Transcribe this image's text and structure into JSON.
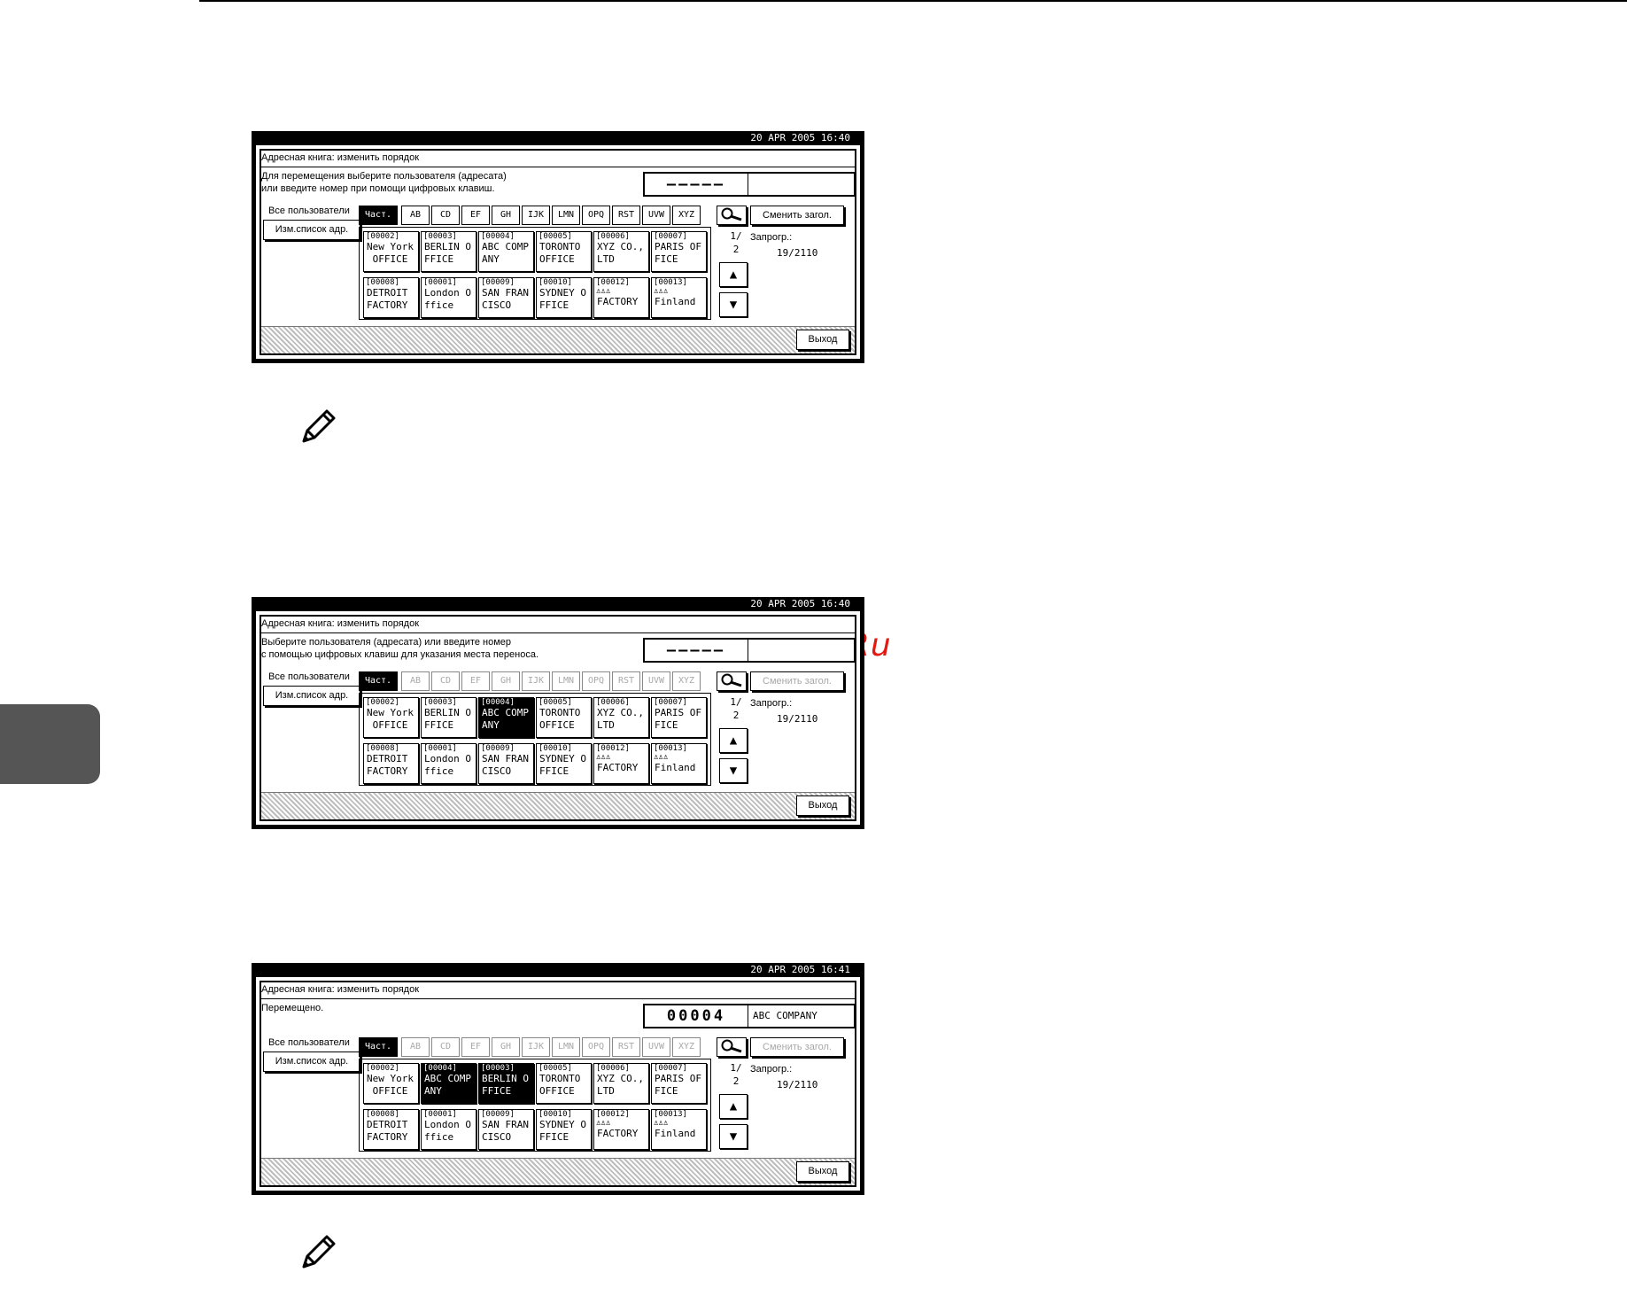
{
  "watermark": "McGrp.Ru",
  "screens": [
    {
      "datetime": "20 APR  2005 16:40",
      "title": "Адресная книга: изменить порядок",
      "message_line1": "Для перемещения выберите пользователя (адресата)",
      "message_line2": "или введите номер при помощи цифровых клавиш.",
      "number": "—————",
      "number_name": "",
      "all_users": "Все пользователи",
      "edit_list_btn": "Изм.список адр.",
      "tabs": [
        {
          "label": "Част.",
          "state": "selected"
        },
        {
          "label": "AB",
          "state": "enabled"
        },
        {
          "label": "CD",
          "state": "enabled"
        },
        {
          "label": "EF",
          "state": "enabled"
        },
        {
          "label": "GH",
          "state": "enabled"
        },
        {
          "label": "IJK",
          "state": "enabled"
        },
        {
          "label": "LMN",
          "state": "enabled"
        },
        {
          "label": "OPQ",
          "state": "enabled"
        },
        {
          "label": "RST",
          "state": "enabled"
        },
        {
          "label": "UVW",
          "state": "enabled"
        },
        {
          "label": "XYZ",
          "state": "enabled"
        }
      ],
      "switch_title_btn": "Сменить загол.",
      "switch_title_state": "enabled",
      "page_num": "1/",
      "page_total": "2",
      "registered_label": "Запрогр.:",
      "registered_count": "19/2110",
      "exit_btn": "Выход",
      "entries": [
        {
          "id": "[00002]",
          "line1": "New York",
          "line2": " OFFICE",
          "selected": false
        },
        {
          "id": "[00003]",
          "line1": "BERLIN O",
          "line2": "FFICE",
          "selected": false
        },
        {
          "id": "[00004]",
          "line1": "ABC COMP",
          "line2": "ANY",
          "selected": false
        },
        {
          "id": "[00005]",
          "line1": "TORONTO",
          "line2": "OFFICE",
          "selected": false
        },
        {
          "id": "[00006]",
          "line1": "XYZ CO.,",
          "line2": "LTD",
          "selected": false
        },
        {
          "id": "[00007]",
          "line1": "PARIS OF",
          "line2": "FICE",
          "selected": false
        },
        {
          "id": "[00008]",
          "line1": "DETROIT",
          "line2": "FACTORY",
          "selected": false
        },
        {
          "id": "[00001]",
          "line1": "London O",
          "line2": "ffice",
          "selected": false
        },
        {
          "id": "[00009]",
          "line1": "SAN FRAN",
          "line2": "CISCO",
          "selected": false
        },
        {
          "id": "[00010]",
          "line1": "SYDNEY O",
          "line2": "FFICE",
          "selected": false
        },
        {
          "id": "[00012] ♙♙♙",
          "line1": "FACTORY",
          "line2": "",
          "selected": false
        },
        {
          "id": "[00013] ♙♙♙",
          "line1": "Finland",
          "line2": "",
          "selected": false
        }
      ]
    },
    {
      "datetime": "20 APR  2005 16:40",
      "title": "Адресная книга: изменить порядок",
      "message_line1": "Выберите пользователя (адресата) или введите номер",
      "message_line2": "с помощью цифровых клавиш для указания места переноса.",
      "number": "—————",
      "number_name": "",
      "all_users": "Все пользователи",
      "edit_list_btn": "Изм.список адр.",
      "tabs": [
        {
          "label": "Част.",
          "state": "selected"
        },
        {
          "label": "AB",
          "state": "disabled"
        },
        {
          "label": "CD",
          "state": "disabled"
        },
        {
          "label": "EF",
          "state": "disabled"
        },
        {
          "label": "GH",
          "state": "disabled"
        },
        {
          "label": "IJK",
          "state": "disabled"
        },
        {
          "label": "LMN",
          "state": "disabled"
        },
        {
          "label": "OPQ",
          "state": "disabled"
        },
        {
          "label": "RST",
          "state": "disabled"
        },
        {
          "label": "UVW",
          "state": "disabled"
        },
        {
          "label": "XYZ",
          "state": "disabled"
        }
      ],
      "switch_title_btn": "Сменить загол.",
      "switch_title_state": "disabled",
      "page_num": "1/",
      "page_total": "2",
      "registered_label": "Запрогр.:",
      "registered_count": "19/2110",
      "exit_btn": "Выход",
      "entries": [
        {
          "id": "[00002]",
          "line1": "New York",
          "line2": " OFFICE",
          "selected": false
        },
        {
          "id": "[00003]",
          "line1": "BERLIN O",
          "line2": "FFICE",
          "selected": false
        },
        {
          "id": "[00004]",
          "line1": "ABC COMP",
          "line2": "ANY",
          "selected": true
        },
        {
          "id": "[00005]",
          "line1": "TORONTO",
          "line2": "OFFICE",
          "selected": false
        },
        {
          "id": "[00006]",
          "line1": "XYZ CO.,",
          "line2": "LTD",
          "selected": false
        },
        {
          "id": "[00007]",
          "line1": "PARIS OF",
          "line2": "FICE",
          "selected": false
        },
        {
          "id": "[00008]",
          "line1": "DETROIT",
          "line2": "FACTORY",
          "selected": false
        },
        {
          "id": "[00001]",
          "line1": "London O",
          "line2": "ffice",
          "selected": false
        },
        {
          "id": "[00009]",
          "line1": "SAN FRAN",
          "line2": "CISCO",
          "selected": false
        },
        {
          "id": "[00010]",
          "line1": "SYDNEY O",
          "line2": "FFICE",
          "selected": false
        },
        {
          "id": "[00012] ♙♙♙",
          "line1": "FACTORY",
          "line2": "",
          "selected": false
        },
        {
          "id": "[00013] ♙♙♙",
          "line1": "Finland",
          "line2": "",
          "selected": false
        }
      ]
    },
    {
      "datetime": "20 APR  2005 16:41",
      "title": "Адресная книга: изменить порядок",
      "message_line1": "Перемещено.",
      "message_line2": "",
      "number": "00004",
      "number_name": "ABC COMPANY",
      "all_users": "Все пользователи",
      "edit_list_btn": "Изм.список адр.",
      "tabs": [
        {
          "label": "Част.",
          "state": "selected"
        },
        {
          "label": "AB",
          "state": "disabled"
        },
        {
          "label": "CD",
          "state": "disabled"
        },
        {
          "label": "EF",
          "state": "disabled"
        },
        {
          "label": "GH",
          "state": "disabled"
        },
        {
          "label": "IJK",
          "state": "disabled"
        },
        {
          "label": "LMN",
          "state": "disabled"
        },
        {
          "label": "OPQ",
          "state": "disabled"
        },
        {
          "label": "RST",
          "state": "disabled"
        },
        {
          "label": "UVW",
          "state": "disabled"
        },
        {
          "label": "XYZ",
          "state": "disabled"
        }
      ],
      "switch_title_btn": "Сменить загол.",
      "switch_title_state": "disabled",
      "page_num": "1/",
      "page_total": "2",
      "registered_label": "Запрогр.:",
      "registered_count": "19/2110",
      "exit_btn": "Выход",
      "entries": [
        {
          "id": "[00002]",
          "line1": "New York",
          "line2": " OFFICE",
          "selected": false
        },
        {
          "id": "[00004]",
          "line1": "ABC COMP",
          "line2": "ANY",
          "selected": true
        },
        {
          "id": "[00003]",
          "line1": "BERLIN O",
          "line2": "FFICE",
          "selected": true
        },
        {
          "id": "[00005]",
          "line1": "TORONTO",
          "line2": "OFFICE",
          "selected": false
        },
        {
          "id": "[00006]",
          "line1": "XYZ CO.,",
          "line2": "LTD",
          "selected": false
        },
        {
          "id": "[00007]",
          "line1": "PARIS OF",
          "line2": "FICE",
          "selected": false
        },
        {
          "id": "[00008]",
          "line1": "DETROIT",
          "line2": "FACTORY",
          "selected": false
        },
        {
          "id": "[00001]",
          "line1": "London O",
          "line2": "ffice",
          "selected": false
        },
        {
          "id": "[00009]",
          "line1": "SAN FRAN",
          "line2": "CISCO",
          "selected": false
        },
        {
          "id": "[00010]",
          "line1": "SYDNEY O",
          "line2": "FFICE",
          "selected": false
        },
        {
          "id": "[00012] ♙♙♙",
          "line1": "FACTORY",
          "line2": "",
          "selected": false
        },
        {
          "id": "[00013] ♙♙♙",
          "line1": "Finland",
          "line2": "",
          "selected": false
        }
      ]
    }
  ]
}
